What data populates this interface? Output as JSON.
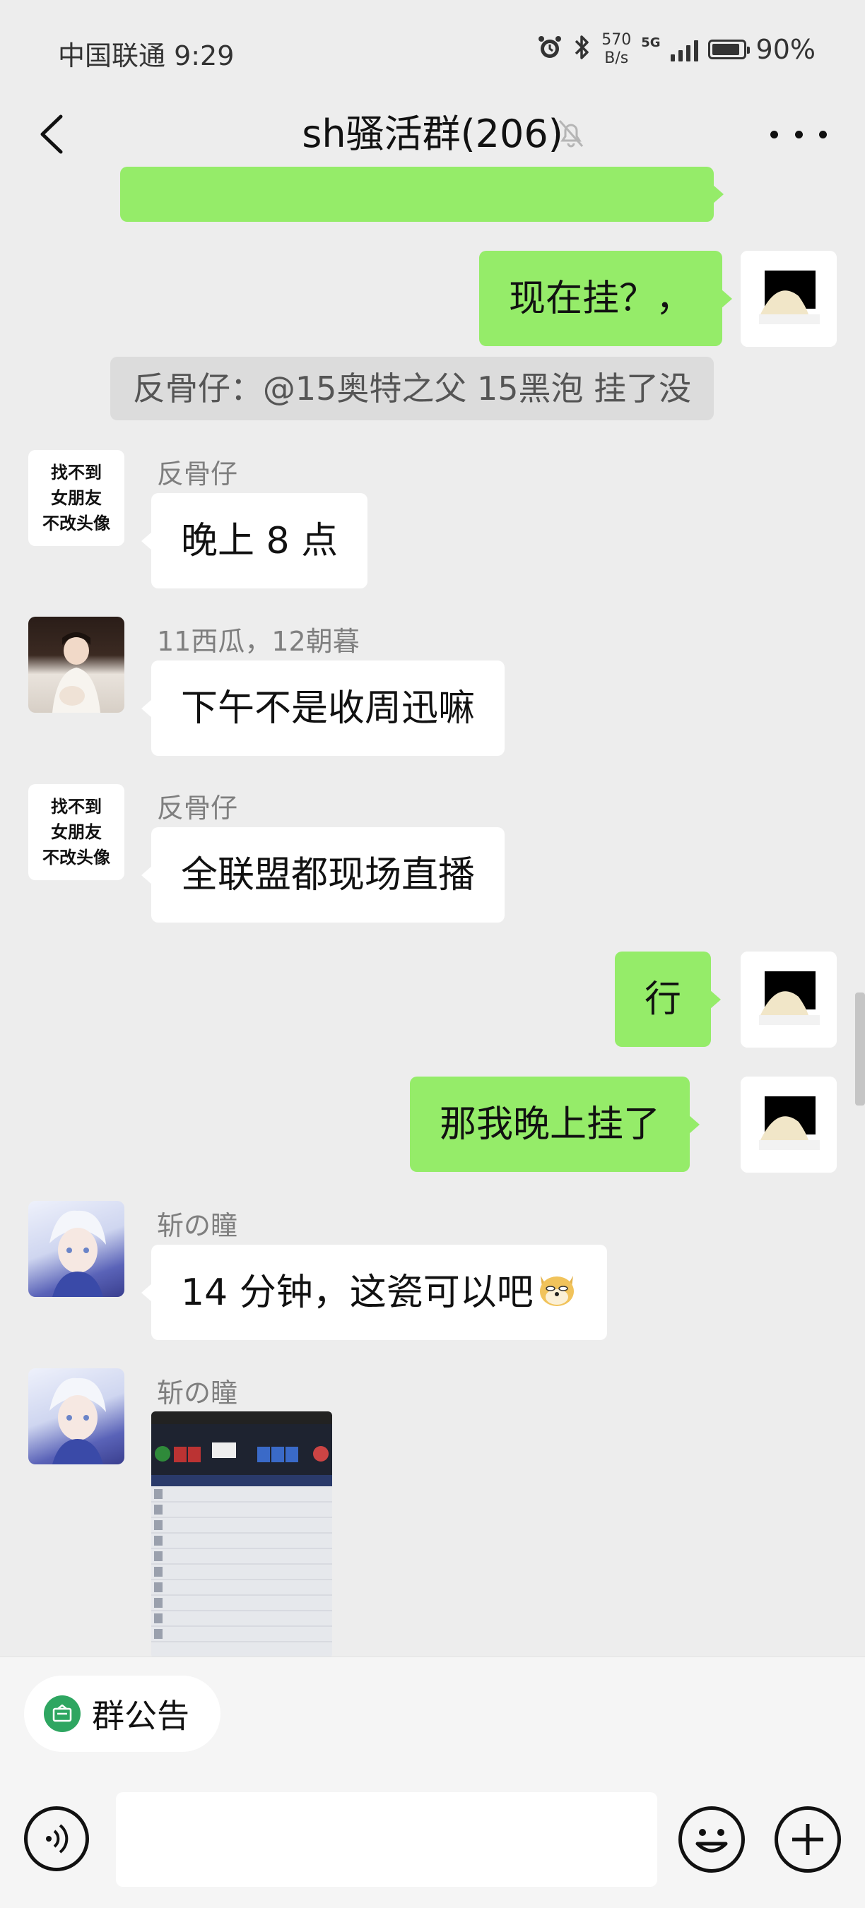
{
  "status_bar": {
    "carrier_time": "中国联通 9:29",
    "net_speed_value": "570",
    "net_speed_unit": "B/s",
    "network_type": "5G",
    "battery_percent": "90%",
    "battery_level": 0.9,
    "icons": [
      "alarm-icon",
      "bluetooth-icon",
      "signal-icon",
      "battery-icon"
    ]
  },
  "header": {
    "title": "sh骚活群(206)",
    "back_icon": "chevron-left-icon",
    "mute_icon": "bell-muted-icon",
    "more_icon": "more-dots-icon"
  },
  "messages": [
    {
      "side": "me",
      "text": "现在挂？，"
    },
    {
      "type": "system",
      "text": "反骨仔：@15奥特之父 15黑泡 挂了没"
    },
    {
      "side": "other",
      "sender": "反骨仔",
      "avatar_text": [
        "找不到",
        "女朋友",
        "不改头像"
      ],
      "text": "晚上 8 点"
    },
    {
      "side": "other",
      "sender": "11西瓜，12朝暮",
      "text": "下午不是收周迅嘛"
    },
    {
      "side": "other",
      "sender": "反骨仔",
      "avatar_text": [
        "找不到",
        "女朋友",
        "不改头像"
      ],
      "text": "全联盟都现场直播"
    },
    {
      "side": "me",
      "text": "行"
    },
    {
      "side": "me",
      "text": "那我晚上挂了"
    },
    {
      "side": "other",
      "sender": "斩の瞳",
      "text": "14 分钟，这瓷可以吧",
      "emoji": "doge-emoji"
    },
    {
      "side": "other",
      "sender": "斩の瞳",
      "type": "image"
    }
  ],
  "footer": {
    "announcement_label": "群公告",
    "input_placeholder": "",
    "colors": {
      "accent_green": "#95ec69",
      "announce_green": "#2ea661"
    }
  }
}
